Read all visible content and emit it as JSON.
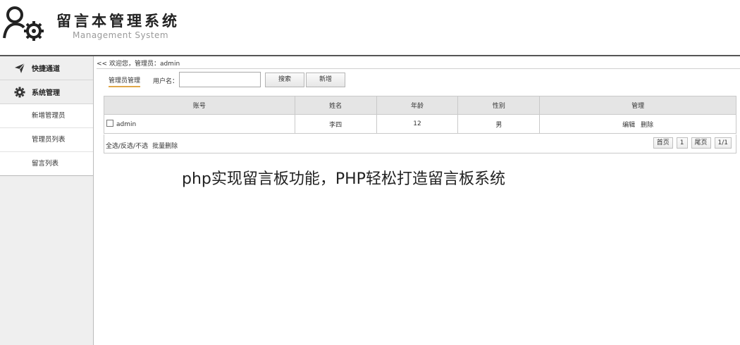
{
  "header": {
    "title": "留言本管理系统",
    "subtitle": "Management System",
    "logo_icon": "user-gear-icon"
  },
  "sidebar": {
    "sections": [
      {
        "label": "快捷通道",
        "icon": "paper-plane-icon"
      },
      {
        "label": "系统管理",
        "icon": "gear-icon"
      }
    ],
    "items": [
      {
        "label": "新增管理员"
      },
      {
        "label": "管理员列表"
      },
      {
        "label": "留言列表"
      }
    ]
  },
  "breadcrumb": {
    "text": "<< 欢迎您，管理员：admin"
  },
  "toolbar": {
    "tab_label": "管理员管理",
    "username_label": "用户名：",
    "username_value": "",
    "username_placeholder": "",
    "search_label": "搜索",
    "add_label": "新增"
  },
  "table": {
    "columns": [
      "账号",
      "姓名",
      "年龄",
      "性别",
      "管理"
    ],
    "rows": [
      {
        "account": "admin",
        "name": "李四",
        "age": "12",
        "gender": "男",
        "edit": "编辑",
        "delete": "删除"
      }
    ]
  },
  "footer": {
    "select_label": "全选/反选/不选",
    "batch_delete_label": "批量删除",
    "pager": {
      "first": "首页",
      "current": "1",
      "last": "尾页",
      "summary": "1/1"
    }
  },
  "caption": "php实现留言板功能，PHP轻松打造留言板系统"
}
